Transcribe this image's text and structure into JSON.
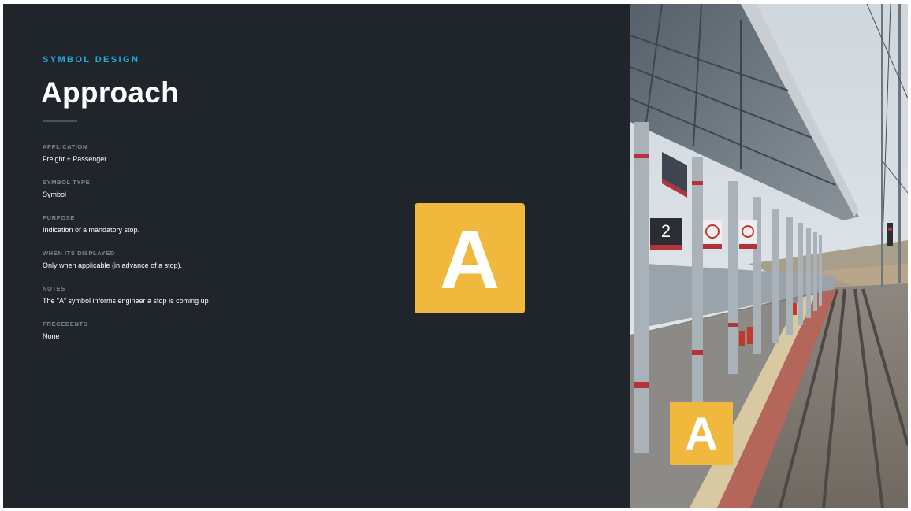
{
  "header": {
    "kicker": "SYMBOL DESIGN",
    "title": "Approach"
  },
  "fields": [
    {
      "label": "APPLICATION",
      "value": "Freight + Passenger"
    },
    {
      "label": "SYMBOL TYPE",
      "value": "Symbol"
    },
    {
      "label": "PURPOSE",
      "value": "Indication of a mandatory stop."
    },
    {
      "label": "WHEN ITS DISPLAYED",
      "value": "Only when applicable (in advance of a stop)."
    },
    {
      "label": "NOTES",
      "value": "The “A” symbol informs engineer a stop is coming up"
    },
    {
      "label": "PRECEDENTS",
      "value": "None"
    }
  ],
  "symbol": {
    "letter": "A",
    "color": "#f0b83c"
  },
  "photo": {
    "platform_number": "2",
    "overlay_letter": "A"
  },
  "colors": {
    "background": "#1f252b",
    "accent": "#1eaee0",
    "label": "#7f868d",
    "text": "#ffffff"
  }
}
